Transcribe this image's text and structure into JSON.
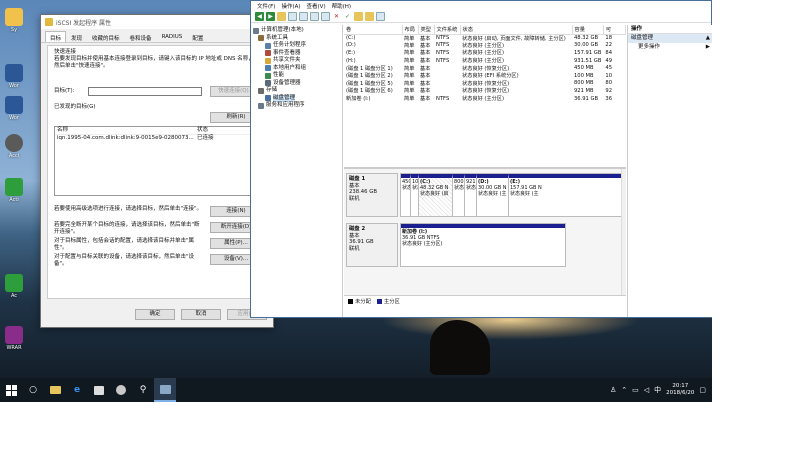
{
  "desktop": {
    "icons": [
      {
        "label": "Sy",
        "color": "#f0c24b"
      },
      {
        "label": "Wor",
        "color": "#2b5797"
      },
      {
        "label": "Wor",
        "color": "#2b5797"
      },
      {
        "label": "Acci",
        "color": "#5a5a5a"
      },
      {
        "label": "Acti",
        "color": "#2e9d3b"
      },
      {
        "label": "Ac",
        "color": "#2e9d3b"
      },
      {
        "label": "WRAR",
        "color": "#8a2d8a"
      }
    ]
  },
  "iscsi": {
    "title": "iSCSI 发起程序 属性",
    "tabs": [
      "目标",
      "发现",
      "收藏的目标",
      "卷和设备",
      "RADIUS",
      "配置"
    ],
    "quick_connect_heading": "快速连接",
    "quick_connect_desc": "若要发现目标并使用基本连接登录到目标，请键入该目标的 IP 地址或 DNS 名称，然后单击\"快速连接\"。",
    "target_label": "目标(T):",
    "target_value": "",
    "quick_connect_button": "快速连接(Q)...",
    "discovered_heading": "已发现的目标(G)",
    "refresh_button": "刷新(R)",
    "table_headers": [
      "名称",
      "状态"
    ],
    "targets": [
      {
        "name": "iqn.1995-04.com.dlink:dlink:9-0015e9-0280073...",
        "status": "已连接"
      }
    ],
    "actions": [
      {
        "desc": "若要使用高级选项进行连接，请选择目标，然后单击\"连接\"。",
        "button": "连接(N)"
      },
      {
        "desc": "若要完全断开某个目标的连接，请选择该目标，然后单击\"断开连接\"。",
        "button": "断开连接(D)"
      },
      {
        "desc": "对于目标属性，包括会话的配置，请选择该目标并单击\"属性\"。",
        "button": "属性(P)..."
      },
      {
        "desc": "对于配置与目标关联的设备，请选择该目标，然后单击\"设备\"。",
        "button": "设备(V)..."
      }
    ],
    "ok_button": "确定",
    "cancel_button": "取消",
    "apply_button": "应用(A)"
  },
  "cm": {
    "menu": [
      "文件(F)",
      "操作(A)",
      "查看(V)",
      "帮助(H)"
    ],
    "tree": [
      {
        "label": "计算机管理(本地)",
        "level": 0,
        "color": "#6b7b8c"
      },
      {
        "label": "系统工具",
        "level": 1,
        "color": "#8c6b3c"
      },
      {
        "label": "任务计划程序",
        "level": 2,
        "color": "#5a7fa8"
      },
      {
        "label": "事件查看器",
        "level": 2,
        "color": "#b04a3a"
      },
      {
        "label": "共享文件夹",
        "level": 2,
        "color": "#d6a93b"
      },
      {
        "label": "本地用户和组",
        "level": 2,
        "color": "#4a7fb0"
      },
      {
        "label": "性能",
        "level": 2,
        "color": "#3a8a4a"
      },
      {
        "label": "设备管理器",
        "level": 2,
        "color": "#5a6a7a"
      },
      {
        "label": "存储",
        "level": 1,
        "color": "#6a6a6a"
      },
      {
        "label": "磁盘管理",
        "level": 2,
        "color": "#4a6fa0",
        "selected": true
      },
      {
        "label": "服务和应用程序",
        "level": 1,
        "color": "#6a7a8a"
      }
    ],
    "columns": [
      "卷",
      "布局",
      "类型",
      "文件系统",
      "状态",
      "容量",
      "可"
    ],
    "volumes": [
      [
        "(C:)",
        "简单",
        "基本",
        "NTFS",
        "状态良好 (启动, 页面文件, 故障转储, 主分区)",
        "48.32 GB",
        "18"
      ],
      [
        "(D:)",
        "简单",
        "基本",
        "NTFS",
        "状态良好 (主分区)",
        "30.00 GB",
        "22"
      ],
      [
        "(E:)",
        "简单",
        "基本",
        "NTFS",
        "状态良好 (主分区)",
        "157.91 GB",
        "84"
      ],
      [
        "(H:)",
        "简单",
        "基本",
        "NTFS",
        "状态良好 (主分区)",
        "931.51 GB",
        "49"
      ],
      [
        "(磁盘 1 磁盘分区 1)",
        "简单",
        "基本",
        "",
        "状态良好 (恢复分区)",
        "450 MB",
        "45"
      ],
      [
        "(磁盘 1 磁盘分区 2)",
        "简单",
        "基本",
        "",
        "状态良好 (EFI 系统分区)",
        "100 MB",
        "10"
      ],
      [
        "(磁盘 1 磁盘分区 5)",
        "简单",
        "基本",
        "",
        "状态良好 (恢复分区)",
        "800 MB",
        "80"
      ],
      [
        "(磁盘 1 磁盘分区 6)",
        "简单",
        "基本",
        "",
        "状态良好 (恢复分区)",
        "921 MB",
        "92"
      ],
      [
        "新加卷 (I:)",
        "简单",
        "基本",
        "NTFS",
        "状态良好 (主分区)",
        "36.91 GB",
        "36"
      ]
    ],
    "disks": [
      {
        "name": "磁盘 1",
        "type": "基本",
        "size": "238.46 GB",
        "status": "联机",
        "partitions": [
          {
            "name": "",
            "size": "450 M",
            "status": "状态良"
          },
          {
            "name": "",
            "size": "100",
            "status": "状态"
          },
          {
            "name": "(C:)",
            "size": "48.32 GB N",
            "status": "状态良好 (启"
          },
          {
            "name": "",
            "size": "800 M",
            "status": "状态良"
          },
          {
            "name": "",
            "size": "921 M",
            "status": "状态良"
          },
          {
            "name": "(D:)",
            "size": "30.00 GB N",
            "status": "状态良好 (主"
          },
          {
            "name": "(E:)",
            "size": "157.91 GB N",
            "status": "状态良好 (主"
          }
        ]
      },
      {
        "name": "磁盘 2",
        "type": "基本",
        "size": "36.91 GB",
        "status": "联机",
        "partitions": [
          {
            "name": "新加卷 (I:)",
            "size": "36.91 GB NTFS",
            "status": "状态良好 (主分区)"
          }
        ]
      }
    ],
    "legend": [
      {
        "label": "未分配",
        "color": "#000000"
      },
      {
        "label": "主分区",
        "color": "#1b1f8f"
      }
    ],
    "actions_header": "操作",
    "actions_selected": "磁盘管理",
    "actions_more": "更多操作"
  },
  "taskbar": {
    "time": "20:17",
    "date": "2018/6/20"
  }
}
